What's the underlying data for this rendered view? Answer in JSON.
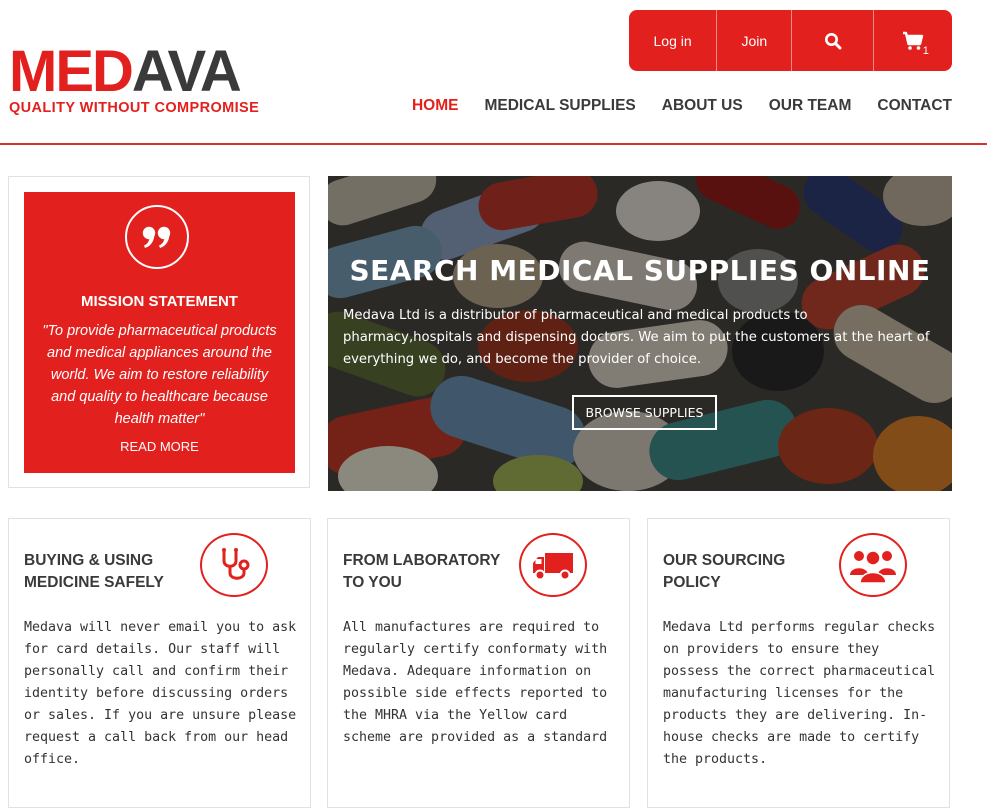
{
  "brand": {
    "logo_red": "MED",
    "logo_dark": "AVA",
    "tagline": "QUALITY WITHOUT COMPROMISE",
    "accent_color": "#e2201d",
    "dark_color": "#3a3a3a"
  },
  "topbar": {
    "login": "Log in",
    "join": "Join",
    "search_icon": "search-icon",
    "cart_icon": "cart-icon",
    "cart_count": "1"
  },
  "nav": {
    "items": [
      "HOME",
      "MEDICAL SUPPLIES",
      "ABOUT US",
      "OUR TEAM",
      "CONTACT"
    ],
    "active": "HOME"
  },
  "mission": {
    "icon": "quote-icon",
    "title": "MISSION STATEMENT",
    "text": "\"To provide pharmaceutical products and medical appliances around the world. We aim to restore reliability and quality to healthcare because health matter\"",
    "link": "READ MORE"
  },
  "hero": {
    "title": "SEARCH MEDICAL SUPPLIES ONLINE",
    "text": "Medava Ltd is a distributor of pharmaceutical and medical products to pharmacy,hospitals and dispensing doctors. We aim to put the customers at the heart of everything we do, and become the provider of choice.",
    "button": "BROWSE SUPPLIES"
  },
  "cards": [
    {
      "title_line1": "BUYING & USING",
      "title_line2": "MEDICINE SAFELY",
      "icon": "stethoscope-icon",
      "text": "Medava will never email you to ask for card details. Our staff will personally call and confirm their identity before discussing orders or sales. If you are unsure please request a call back from our head office."
    },
    {
      "title_line1": "FROM LABORATORY",
      "title_line2": "TO YOU",
      "icon": "truck-icon",
      "text": "All manufactures are required to regularly certify conformaty with Medava. Adequare information on possible side effects reported to the MHRA via the Yellow card scheme are provided as a standard"
    },
    {
      "title_line1": "OUR SOURCING",
      "title_line2": "POLICY",
      "icon": "team-icon",
      "text": "Medava Ltd performs regular checks on providers to ensure they possess the correct pharmaceutical manufacturing licenses for the products they are delivering. In-house checks are made to certify the products."
    }
  ]
}
